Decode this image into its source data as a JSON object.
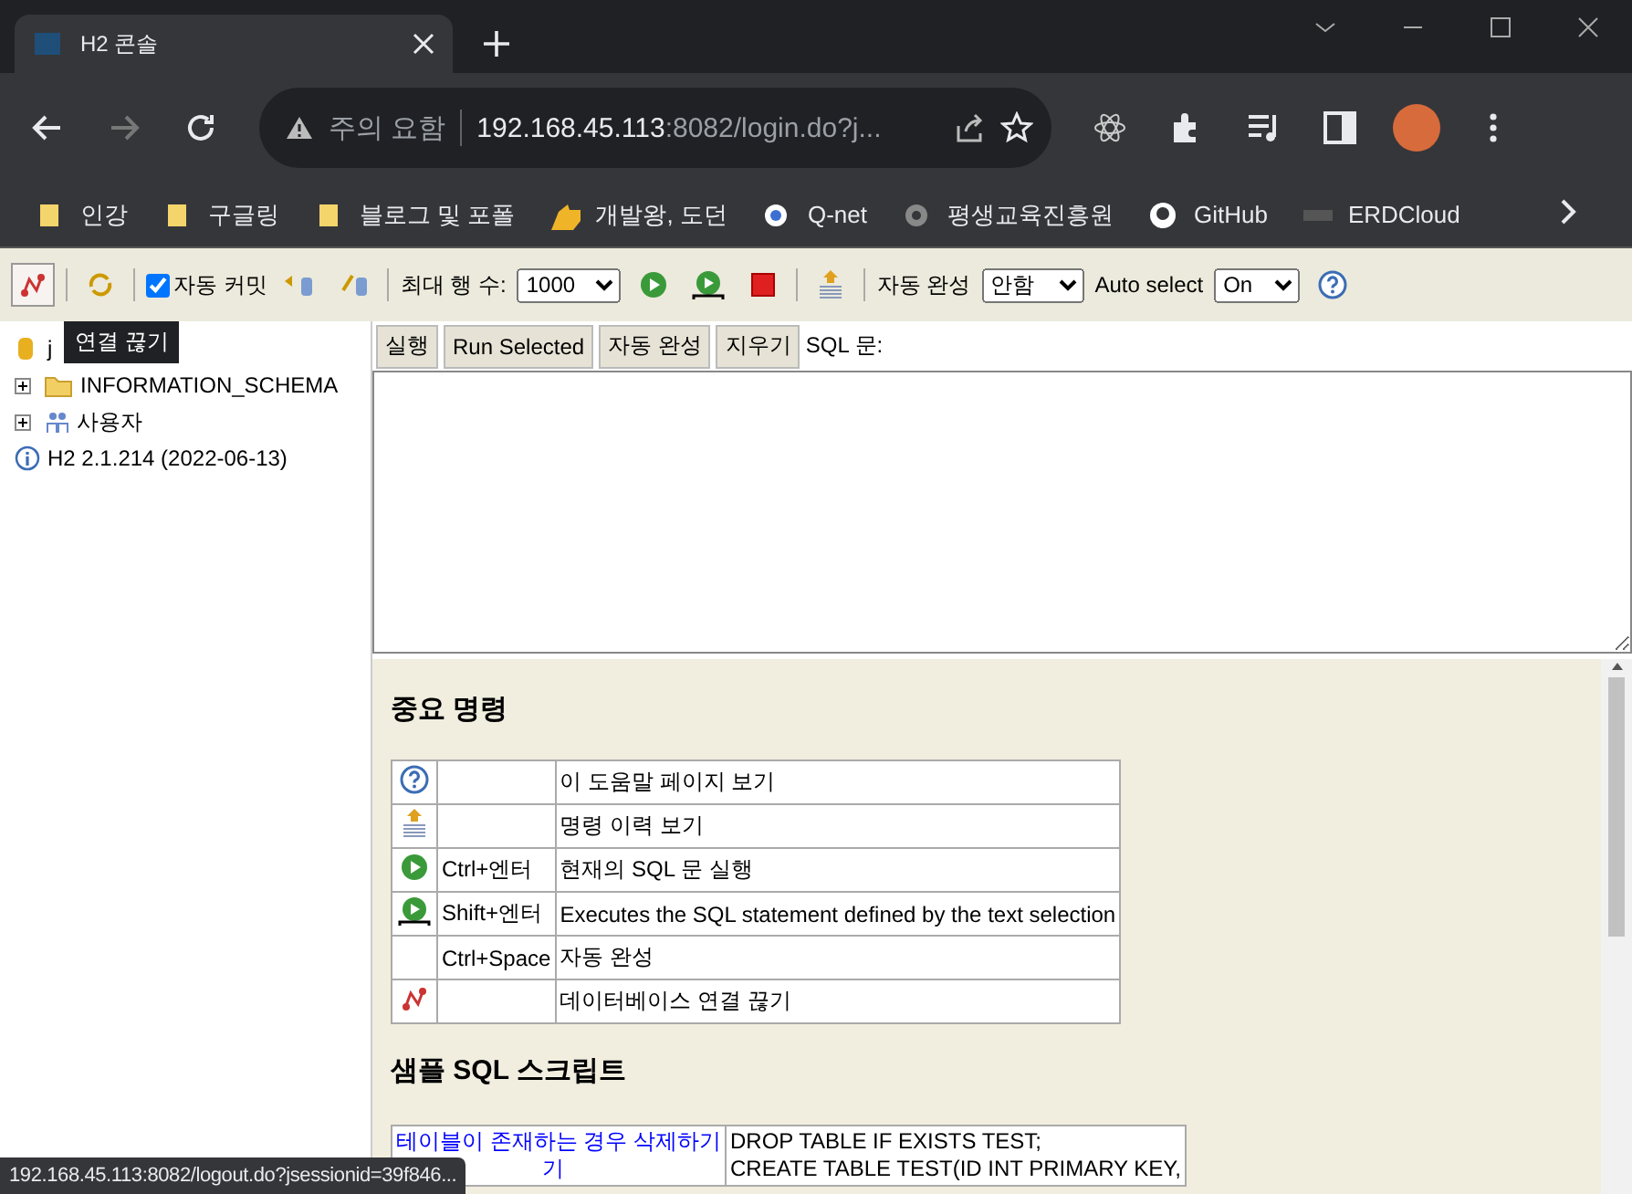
{
  "browser": {
    "tab": {
      "title": "H2 콘솔"
    },
    "address": {
      "warning": "주의 요함",
      "host": "192.168.45.113",
      "rest": ":8082/login.do?j..."
    },
    "bookmarks": [
      {
        "label": "인강",
        "kind": "folder"
      },
      {
        "label": "구글링",
        "kind": "folder"
      },
      {
        "label": "블로그 및 포폴",
        "kind": "folder"
      },
      {
        "label": "개발왕, 도던",
        "kind": "hand"
      },
      {
        "label": "Q-net",
        "kind": "qnet"
      },
      {
        "label": "평생교육진흥원",
        "kind": "circle"
      },
      {
        "label": "GitHub",
        "kind": "github"
      },
      {
        "label": "ERDCloud",
        "kind": "erd"
      }
    ]
  },
  "toolbar": {
    "auto_commit": {
      "label": "자동 커밋",
      "checked": true
    },
    "max_rows": {
      "label": "최대 행 수:",
      "value": "1000"
    },
    "autocomplete": {
      "label": "자동 완성",
      "value": "안함"
    },
    "auto_select": {
      "label": "Auto select",
      "value": "On"
    }
  },
  "tooltip": "연결 끊기",
  "tree": [
    {
      "label": "j",
      "kind": "db"
    },
    {
      "label": "INFORMATION_SCHEMA",
      "kind": "folder",
      "expanded": false
    },
    {
      "label": "사용자",
      "kind": "users",
      "expanded": false
    },
    {
      "label": "H2 2.1.214 (2022-06-13)",
      "kind": "info"
    }
  ],
  "buttons": [
    "실행",
    "Run Selected",
    "자동 완성",
    "지우기"
  ],
  "sql_label": "SQL 문:",
  "help": {
    "heading": "중요 명령",
    "rows": [
      {
        "kind": "help",
        "key": "",
        "desc": "이 도움말 페이지 보기"
      },
      {
        "kind": "history",
        "key": "",
        "desc": "명령 이력 보기"
      },
      {
        "kind": "run",
        "key": "Ctrl+엔터",
        "desc": "현재의 SQL 문 실행"
      },
      {
        "kind": "runsel",
        "key": "Shift+엔터",
        "desc": "Executes the SQL statement defined by the text selection"
      },
      {
        "kind": "plain",
        "key": "Ctrl+Space",
        "desc": "자동 완성"
      },
      {
        "kind": "disconnect",
        "key": "",
        "desc": "데이터베이스 연결 끊기"
      }
    ],
    "sample_heading": "샘플 SQL 스크립트",
    "samples": [
      {
        "link": [
          "테이블이 존재하는 경우 삭제하기",
          "기"
        ],
        "sql": [
          "DROP TABLE IF EXISTS TEST;",
          "CREATE TABLE TEST(ID INT PRIMARY KEY,"
        ]
      }
    ]
  },
  "status_url": "192.168.45.113:8082/logout.do?jsessionid=39f846..."
}
